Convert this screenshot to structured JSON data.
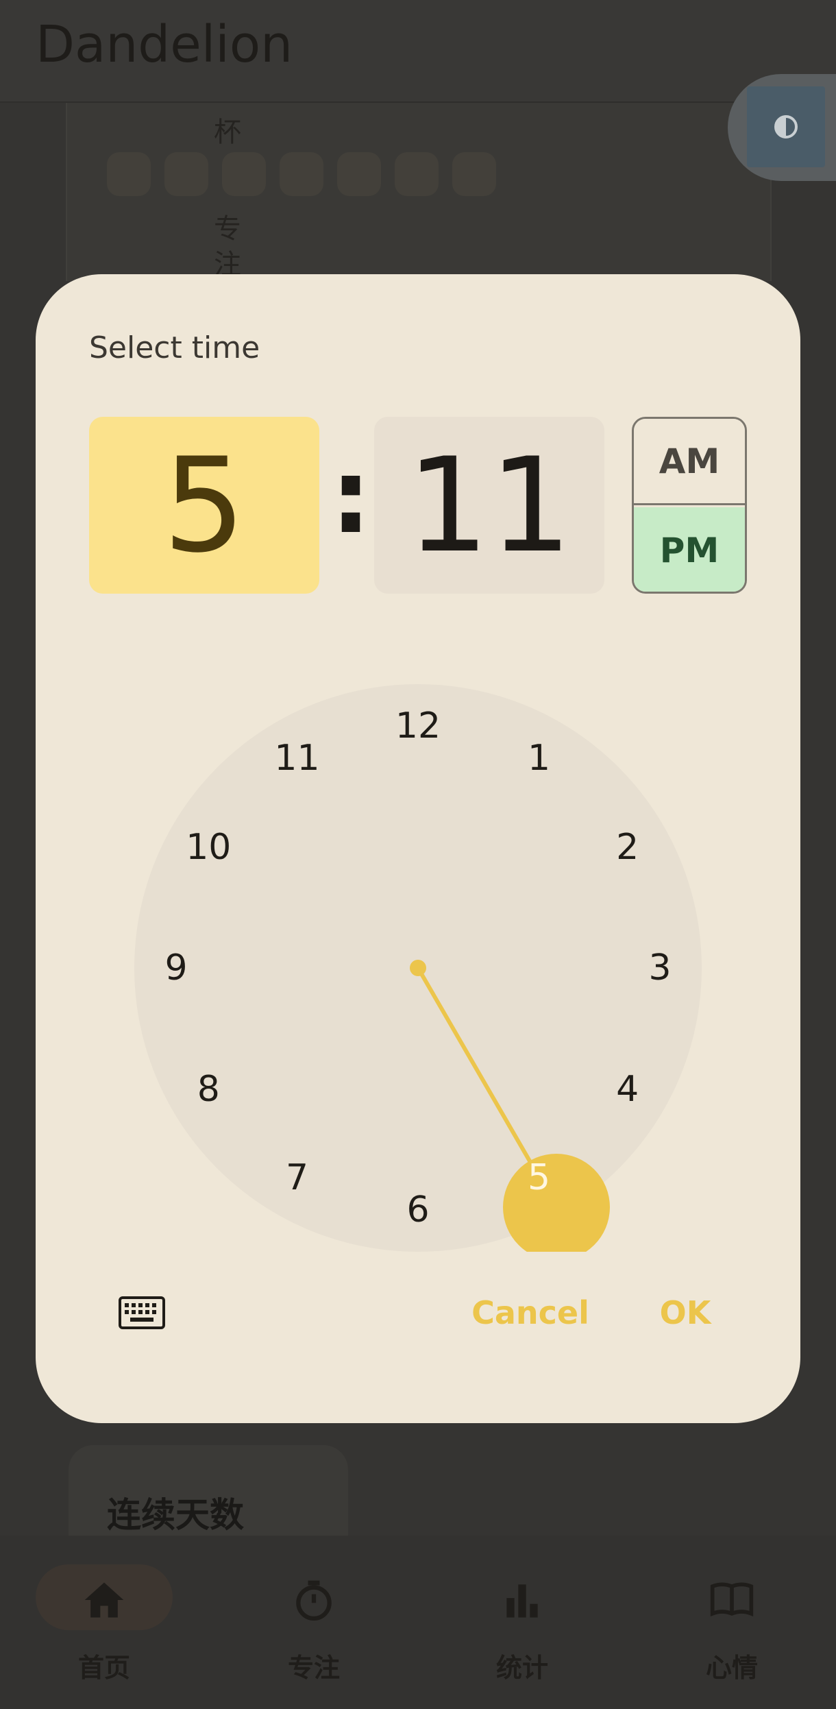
{
  "app": {
    "title": "Dandelion",
    "cup_label": "杯",
    "focus_label": "专注",
    "streak_label": "连续天数"
  },
  "bottom_nav": {
    "items": [
      {
        "label": "首页",
        "icon": "home-icon"
      },
      {
        "label": "专注",
        "icon": "stopwatch-icon"
      },
      {
        "label": "统计",
        "icon": "bar-chart-icon"
      },
      {
        "label": "心情",
        "icon": "book-icon"
      }
    ],
    "active_index": 0
  },
  "dialog": {
    "title": "Select time",
    "hour": "5",
    "colon": ":",
    "minute": "11",
    "am_label": "AM",
    "pm_label": "PM",
    "selected_period": "PM",
    "clock_numbers": [
      "12",
      "1",
      "2",
      "3",
      "4",
      "5",
      "6",
      "7",
      "8",
      "9",
      "10",
      "11"
    ],
    "selected_hour": 5,
    "cancel_label": "Cancel",
    "ok_label": "OK"
  },
  "colors": {
    "accent": "#ecc54b",
    "hour_highlight": "#fbe28c",
    "pm_selected": "#c7ebc7",
    "dialog_bg": "#efe7d7",
    "scrim": "#353432"
  }
}
